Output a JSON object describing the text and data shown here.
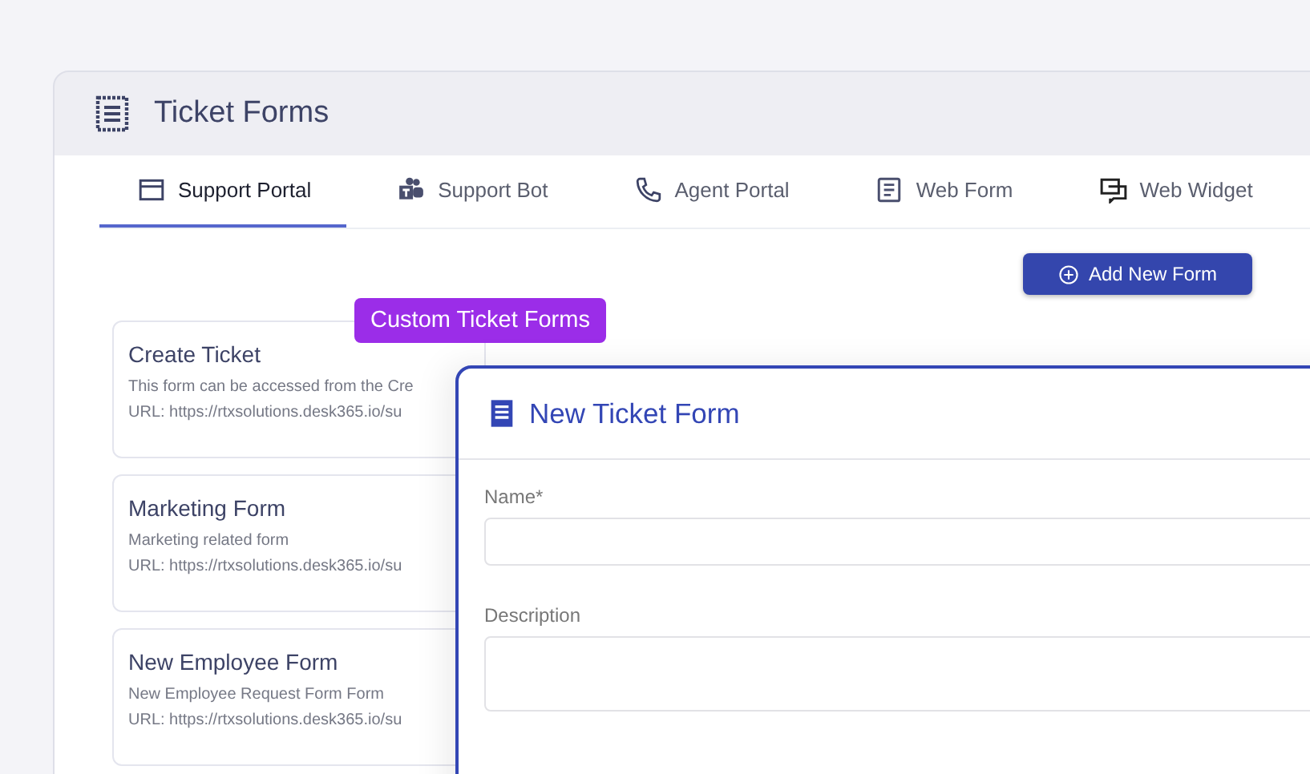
{
  "header": {
    "title": "Ticket Forms"
  },
  "tabs": [
    {
      "label": "Support Portal",
      "kind": "window",
      "selected": true
    },
    {
      "label": "Support Bot",
      "kind": "people",
      "selected": false
    },
    {
      "label": "Agent Portal",
      "kind": "phone",
      "selected": false
    },
    {
      "label": "Web Form",
      "kind": "document",
      "selected": false
    },
    {
      "label": "Web Widget",
      "kind": "chat",
      "selected": false
    }
  ],
  "add_button": {
    "label": "Add New Form"
  },
  "callout": {
    "label": "Custom Ticket Forms"
  },
  "forms": [
    {
      "title": "Create Ticket",
      "description": "This form can be accessed from the Cre",
      "url": "URL: https://rtxsolutions.desk365.io/su"
    },
    {
      "title": "Marketing Form",
      "description": "Marketing related form",
      "url": "URL: https://rtxsolutions.desk365.io/su"
    },
    {
      "title": "New Employee Form",
      "description": "New Employee Request Form Form",
      "url": "URL: https://rtxsolutions.desk365.io/su"
    }
  ],
  "dialog": {
    "title": "New Ticket Form",
    "fields": [
      {
        "label": "Name*",
        "kind": "input"
      },
      {
        "label": "Description",
        "kind": "textarea"
      }
    ]
  }
}
